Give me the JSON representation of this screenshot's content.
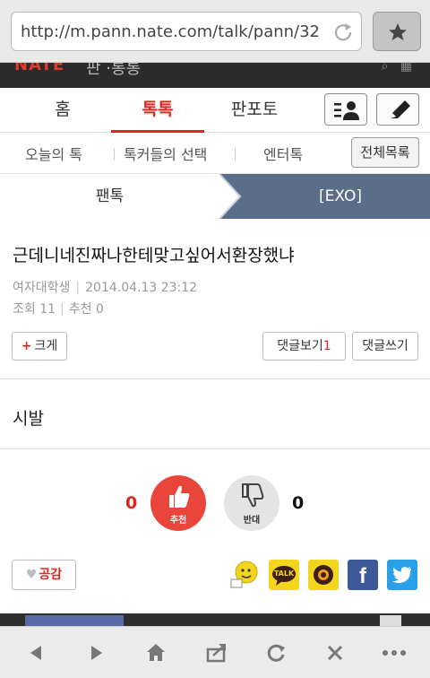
{
  "browser": {
    "url": "http://m.pann.nate.com/talk/pann/32",
    "bookmark_icon": "star-icon",
    "reload_icon": "reload-icon"
  },
  "site_header": {
    "logo": "NATE",
    "subtitle": "판 ·통통"
  },
  "main_tabs": [
    {
      "label": "홈",
      "active": false
    },
    {
      "label": "톡톡",
      "active": true
    },
    {
      "label": "판포토",
      "active": false
    }
  ],
  "sub_tabs": [
    {
      "label": "오늘의 톡"
    },
    {
      "label": "톡커들의 선택"
    },
    {
      "label": "엔터톡"
    }
  ],
  "all_list_label": "전체목록",
  "breadcrumb": {
    "left": "팬톡",
    "right": "[EXO]"
  },
  "post": {
    "title": "근데니네진짜나한테맞고싶어서환장했냐",
    "author": "여자대학생",
    "date": "2014.04.13 23:12",
    "views_label": "조회",
    "views": "11",
    "recommend_label": "추천",
    "recommend": "0",
    "body": "시발"
  },
  "buttons": {
    "text_size": "크게",
    "text_size_plus": "+",
    "view_comments": "댓글보기",
    "comment_count": "1",
    "write_comment": "댓글쓰기",
    "empathy": "공감"
  },
  "vote": {
    "up_count": "0",
    "up_label": "추천",
    "down_label": "반대",
    "down_count": "0"
  },
  "share": {
    "talk_label": "TALK",
    "fb_label": "f"
  },
  "colors": {
    "accent": "#e2261e",
    "breadcrumb_bg": "#5b6e89",
    "facebook": "#3b5998",
    "twitter": "#2aa0e8",
    "kakao": "#f3d51d"
  }
}
